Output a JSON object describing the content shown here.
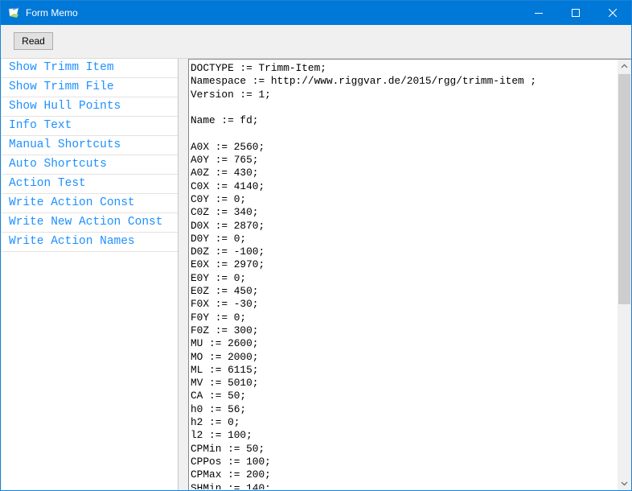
{
  "window": {
    "title": "Form Memo"
  },
  "icons": {
    "app": "app-icon",
    "minimize": "minimize-icon",
    "maximize": "maximize-icon",
    "close": "close-icon",
    "scroll_up": "scroll-up-arrow-icon",
    "scroll_down": "scroll-down-arrow-icon"
  },
  "colors": {
    "titlebar": "#0078d7",
    "list_text": "#1e90ff"
  },
  "toolbar": {
    "read_label": "Read"
  },
  "listbox": {
    "items": [
      {
        "label": "Show Trimm Item"
      },
      {
        "label": "Show Trimm File"
      },
      {
        "label": "Show Hull Points"
      },
      {
        "label": "Info Text"
      },
      {
        "label": "Manual Shortcuts"
      },
      {
        "label": "Auto Shortcuts"
      },
      {
        "label": "Action Test"
      },
      {
        "label": "Write Action Const"
      },
      {
        "label": "Write New Action Const"
      },
      {
        "label": "Write Action Names"
      }
    ]
  },
  "memo": {
    "lines": [
      "DOCTYPE := Trimm-Item;",
      "Namespace := http://www.riggvar.de/2015/rgg/trimm-item ;",
      "Version := 1;",
      "",
      "Name := fd;",
      "",
      "A0X := 2560;",
      "A0Y := 765;",
      "A0Z := 430;",
      "C0X := 4140;",
      "C0Y := 0;",
      "C0Z := 340;",
      "D0X := 2870;",
      "D0Y := 0;",
      "D0Z := -100;",
      "E0X := 2970;",
      "E0Y := 0;",
      "E0Z := 450;",
      "F0X := -30;",
      "F0Y := 0;",
      "F0Z := 300;",
      "MU := 2600;",
      "MO := 2000;",
      "ML := 6115;",
      "MV := 5010;",
      "CA := 50;",
      "h0 := 56;",
      "h2 := 0;",
      "l2 := 100;",
      "CPMin := 50;",
      "CPPos := 100;",
      "CPMax := 200;",
      "SHMin := 140;"
    ]
  }
}
